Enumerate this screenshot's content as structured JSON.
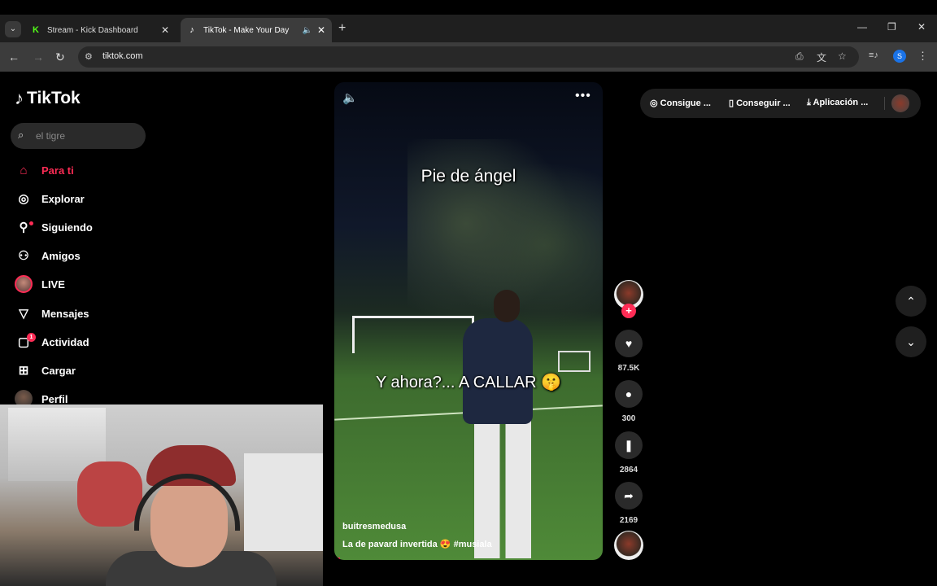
{
  "browser": {
    "tabs": [
      {
        "label": "Stream - Kick Dashboard",
        "favicon": "K",
        "icon": "kick-icon"
      },
      {
        "label": "TikTok - Make Your Day",
        "favicon": "♪",
        "icon": "tiktok-icon"
      }
    ],
    "url": "tiktok.com",
    "profile_initial": "S"
  },
  "tiktok": {
    "logo_text": "TikTok",
    "search_placeholder": "el tigre",
    "nav": [
      {
        "label": "Para ti",
        "icon": "home-icon",
        "active": true
      },
      {
        "label": "Explorar",
        "icon": "compass-icon"
      },
      {
        "label": "Siguiendo",
        "icon": "following-icon"
      },
      {
        "label": "Amigos",
        "icon": "friends-icon"
      },
      {
        "label": "LIVE",
        "icon": "live-avatar"
      },
      {
        "label": "Mensajes",
        "icon": "messages-icon"
      },
      {
        "label": "Actividad",
        "icon": "activity-icon",
        "badge": "1"
      },
      {
        "label": "Cargar",
        "icon": "upload-icon"
      },
      {
        "label": "Perfil",
        "icon": "profile-avatar"
      }
    ],
    "topbar": {
      "coins": "Consigue ...",
      "get_app": "Conseguir ...",
      "app": "Aplicación ..."
    },
    "video": {
      "caption_top": "Pie de ángel",
      "caption_mid": "Y ahora?... A CALLAR 🤫",
      "author": "buitresmedusa",
      "description": "La de pavard invertida 😍 #musiala",
      "progress_fraction": 0.02
    },
    "actions": {
      "likes": "87.5K",
      "comments": "300",
      "saves": "2864",
      "shares": "2169"
    }
  },
  "colors": {
    "accent": "#fe2c55",
    "chrome_bg": "#3c3c3c"
  }
}
